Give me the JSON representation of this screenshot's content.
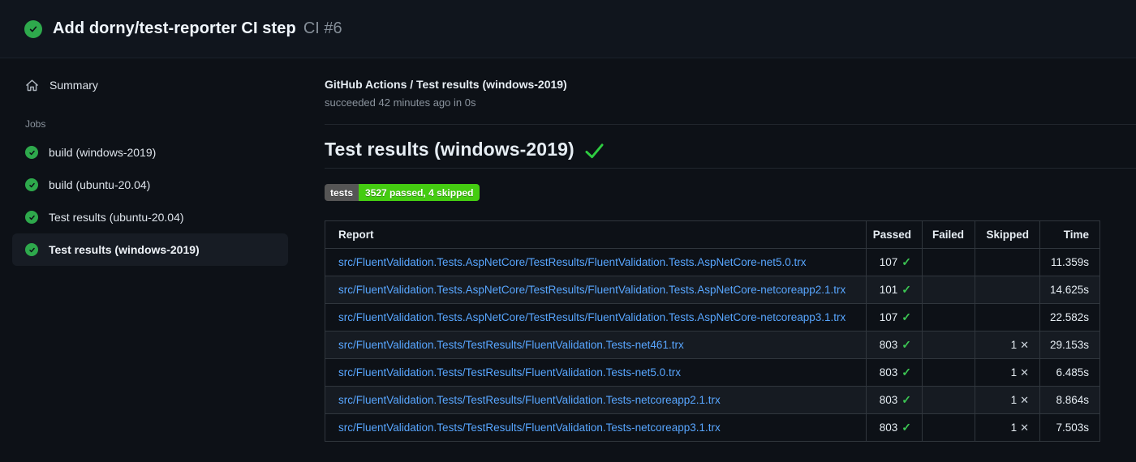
{
  "run_header": {
    "title": "Add dorny/test-reporter CI step",
    "run_number": "CI #6"
  },
  "sidebar": {
    "summary_label": "Summary",
    "jobs_label": "Jobs",
    "jobs": [
      {
        "label": "build (windows-2019)",
        "selected": false
      },
      {
        "label": "build (ubuntu-20.04)",
        "selected": false
      },
      {
        "label": "Test results (ubuntu-20.04)",
        "selected": false
      },
      {
        "label": "Test results (windows-2019)",
        "selected": true
      }
    ]
  },
  "main": {
    "breadcrumb_title": "GitHub Actions / Test results (windows-2019)",
    "status_line": "succeeded 42 minutes ago in 0s",
    "heading": "Test results (windows-2019)",
    "badge": {
      "label": "tests",
      "value": "3527 passed, 4 skipped"
    },
    "table": {
      "headers": {
        "report": "Report",
        "passed": "Passed",
        "failed": "Failed",
        "skipped": "Skipped",
        "time": "Time"
      },
      "rows": [
        {
          "report": "src/FluentValidation.Tests.AspNetCore/TestResults/FluentValidation.Tests.AspNetCore-net5.0.trx",
          "passed": "107",
          "passed_icon": "✓",
          "failed": "",
          "skipped": "",
          "skipped_icon": "",
          "time": "11.359s"
        },
        {
          "report": "src/FluentValidation.Tests.AspNetCore/TestResults/FluentValidation.Tests.AspNetCore-netcoreapp2.1.trx",
          "passed": "101",
          "passed_icon": "✓",
          "failed": "",
          "skipped": "",
          "skipped_icon": "",
          "time": "14.625s"
        },
        {
          "report": "src/FluentValidation.Tests.AspNetCore/TestResults/FluentValidation.Tests.AspNetCore-netcoreapp3.1.trx",
          "passed": "107",
          "passed_icon": "✓",
          "failed": "",
          "skipped": "",
          "skipped_icon": "",
          "time": "22.582s"
        },
        {
          "report": "src/FluentValidation.Tests/TestResults/FluentValidation.Tests-net461.trx",
          "passed": "803",
          "passed_icon": "✓",
          "failed": "",
          "skipped": "1",
          "skipped_icon": "✕",
          "time": "29.153s"
        },
        {
          "report": "src/FluentValidation.Tests/TestResults/FluentValidation.Tests-net5.0.trx",
          "passed": "803",
          "passed_icon": "✓",
          "failed": "",
          "skipped": "1",
          "skipped_icon": "✕",
          "time": "6.485s"
        },
        {
          "report": "src/FluentValidation.Tests/TestResults/FluentValidation.Tests-netcoreapp2.1.trx",
          "passed": "803",
          "passed_icon": "✓",
          "failed": "",
          "skipped": "1",
          "skipped_icon": "✕",
          "time": "8.864s"
        },
        {
          "report": "src/FluentValidation.Tests/TestResults/FluentValidation.Tests-netcoreapp3.1.trx",
          "passed": "803",
          "passed_icon": "✓",
          "failed": "",
          "skipped": "1",
          "skipped_icon": "✕",
          "time": "7.503s"
        }
      ]
    }
  },
  "colors": {
    "page_bg": "#0d1117",
    "header_bg": "#10151d",
    "success_green": "#2ea94c",
    "check_green": "#3cc553",
    "link_blue": "#58a6ff",
    "badge_gray": "#555555",
    "badge_green": "#44cc11",
    "border_gray": "#30363d",
    "zebra_row": "#161b22",
    "muted_text": "#8b949e"
  }
}
